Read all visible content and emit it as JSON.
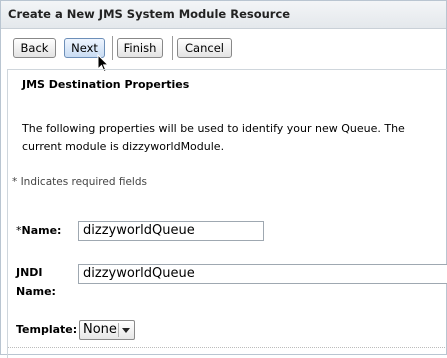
{
  "window": {
    "title": "Create a New JMS System Module Resource"
  },
  "toolbar": {
    "back_label": "Back",
    "next_label": "Next",
    "finish_label": "Finish",
    "cancel_label": "Cancel"
  },
  "section": {
    "heading": "JMS Destination Properties",
    "description": "The following properties will be used to identify your new Queue. The current module is dizzyworldModule.",
    "required_note": "* Indicates required fields"
  },
  "form": {
    "name": {
      "required_mark": "*",
      "label": "Name:",
      "value": "dizzyworldQueue"
    },
    "jndi_name": {
      "label_line1": "JNDI",
      "label_line2": "Name:",
      "value": "dizzyworldQueue"
    },
    "template": {
      "label": "Template:",
      "selected": "None"
    }
  }
}
